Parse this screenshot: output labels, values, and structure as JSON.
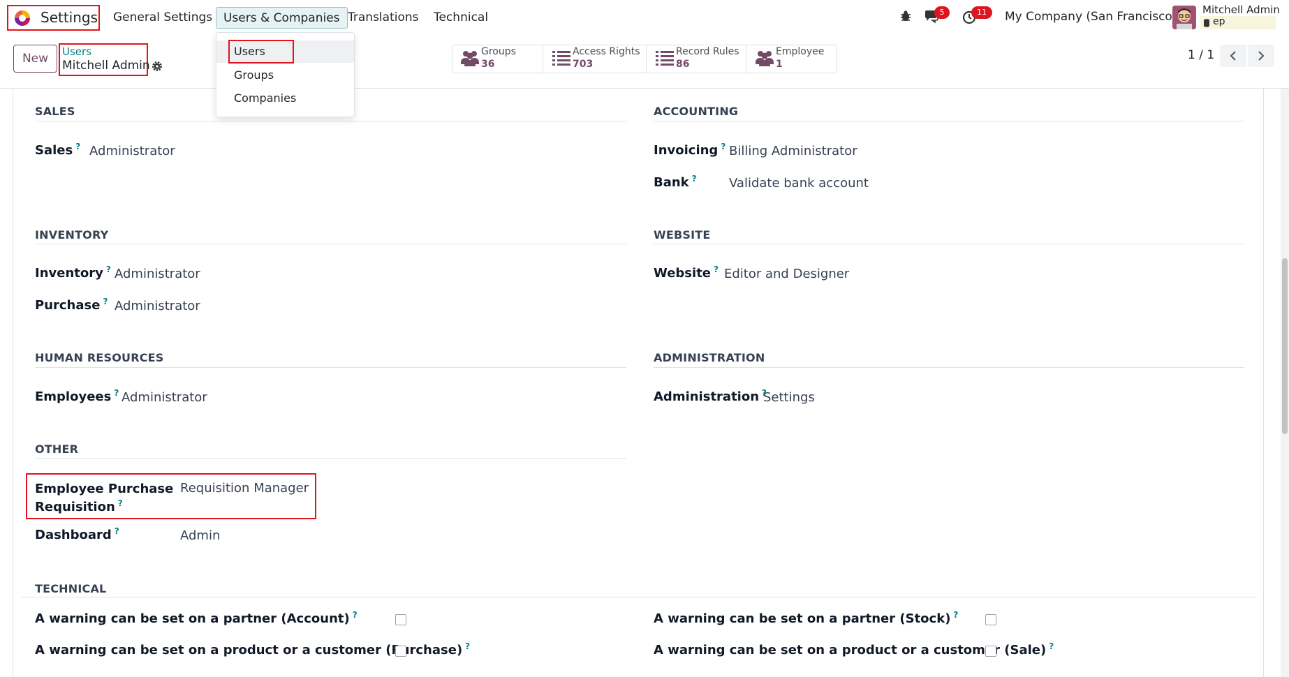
{
  "navbar": {
    "app_name": "Settings",
    "menu": [
      "General Settings",
      "Users & Companies",
      "Translations",
      "Technical"
    ],
    "messages_count": "5",
    "activities_count": "11",
    "company": "My Company (San Francisco)",
    "user_name": "Mitchell Admin",
    "database": "ep"
  },
  "dropdown": {
    "items": [
      "Users",
      "Groups",
      "Companies"
    ]
  },
  "control": {
    "new_label": "New",
    "breadcrumb_parent": "Users",
    "breadcrumb_current": "Mitchell Admin",
    "pager": "1 / 1"
  },
  "stats": [
    {
      "label": "Groups",
      "value": "36",
      "icon": "users-icon"
    },
    {
      "label": "Access Rights",
      "value": "703",
      "icon": "list-icon"
    },
    {
      "label": "Record Rules",
      "value": "86",
      "icon": "list-icon"
    },
    {
      "label": "Employee",
      "value": "1",
      "icon": "users-icon"
    }
  ],
  "sections": {
    "sales": {
      "title": "SALES",
      "fields": [
        {
          "label": "Sales",
          "value": "Administrator"
        }
      ]
    },
    "accounting": {
      "title": "ACCOUNTING",
      "fields": [
        {
          "label": "Invoicing",
          "value": "Billing Administrator"
        },
        {
          "label": "Bank",
          "value": "Validate bank account"
        }
      ]
    },
    "inventory": {
      "title": "INVENTORY",
      "fields": [
        {
          "label": "Inventory",
          "value": "Administrator"
        },
        {
          "label": "Purchase",
          "value": "Administrator"
        }
      ]
    },
    "website": {
      "title": "WEBSITE",
      "fields": [
        {
          "label": "Website",
          "value": "Editor and Designer"
        }
      ]
    },
    "hr": {
      "title": "HUMAN RESOURCES",
      "fields": [
        {
          "label": "Employees",
          "value": "Administrator"
        }
      ]
    },
    "administration": {
      "title": "ADMINISTRATION",
      "fields": [
        {
          "label": "Administration",
          "value": "Settings"
        }
      ]
    },
    "other": {
      "title": "OTHER",
      "fields": [
        {
          "label_line1": "Employee Purchase",
          "label_line2": "Requisition",
          "value": "Requisition Manager"
        },
        {
          "label": "Dashboard",
          "value": "Admin"
        }
      ]
    },
    "technical": {
      "title": "TECHNICAL",
      "fields": [
        {
          "label": "A warning can be set on a partner (Account)",
          "checked": false
        },
        {
          "label": "A warning can be set on a partner (Stock)",
          "checked": false
        },
        {
          "label": "A warning can be set on a product or a customer (Purchase)",
          "checked": false
        },
        {
          "label": "A warning can be set on a product or a customer (Sale)",
          "checked": false
        }
      ]
    }
  },
  "help_mark": "?",
  "colors": {
    "brand": "#714b67",
    "accent": "#017e84",
    "highlight": "#e0141e"
  }
}
